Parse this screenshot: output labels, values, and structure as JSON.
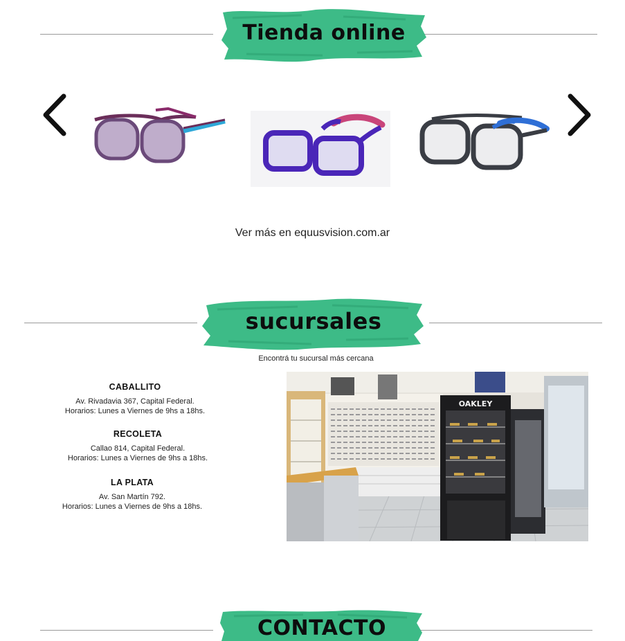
{
  "tienda": {
    "title": "Tienda online",
    "link_text": "Ver más en equusvision.com.ar",
    "prev_icon": "chevron-left-icon",
    "next_icon": "chevron-right-icon",
    "products": [
      {
        "name": "product-purple-frame",
        "frame_color": "#6b4a7a",
        "accent_color": "#2ea8d8"
      },
      {
        "name": "product-violet-frame",
        "frame_color": "#4a26b8",
        "accent_color": "#c9457a"
      },
      {
        "name": "product-gray-frame",
        "frame_color": "#3a3d44",
        "accent_color": "#2f6fd6"
      }
    ]
  },
  "sucursales": {
    "title": "sucursales",
    "subtitle": "Encontrá tu sucursal más cercana",
    "branches": [
      {
        "name": "CABALLITO",
        "address": "Av. Rivadavia 367, Capital Federal.",
        "hours": "Horarios: Lunes a Viernes de 9hs a 18hs."
      },
      {
        "name": "RECOLETA",
        "address": "Callao 814, Capital Federal.",
        "hours": "Horarios: Lunes a Viernes de 9hs a 18hs."
      },
      {
        "name": "LA PLATA",
        "address": "Av. San Martín 792.",
        "hours": "Horarios: Lunes a Viernes de 9hs a 18hs."
      }
    ],
    "store_sign": "OAKLEY"
  },
  "contacto": {
    "title": "CONTACTO"
  },
  "colors": {
    "brush_green": "#3dbb87",
    "rule_gray": "#9a9a9a"
  }
}
